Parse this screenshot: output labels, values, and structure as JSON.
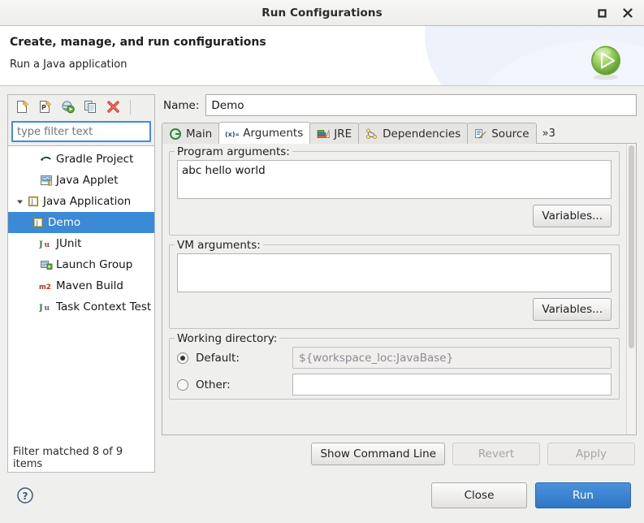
{
  "window": {
    "title": "Run Configurations",
    "buttons": [
      {
        "name": "maximize-button",
        "label": "maximize-icon"
      },
      {
        "name": "close-button",
        "label": "close-icon"
      }
    ]
  },
  "header": {
    "title": "Create, manage, and run configurations",
    "subtitle": "Run a Java application",
    "icon": "run-green-play-icon"
  },
  "left_panel": {
    "toolbar": [
      {
        "name": "new-configuration-button",
        "icon": "new-launch-config-icon",
        "tooltip": "New launch configuration"
      },
      {
        "name": "new-prototype-button",
        "icon": "new-prototype-icon",
        "tooltip": "New prototype"
      },
      {
        "name": "export-button",
        "icon": "export-icon",
        "tooltip": "Export"
      },
      {
        "name": "duplicate-button",
        "icon": "duplicate-icon",
        "tooltip": "Duplicate"
      },
      {
        "name": "delete-button",
        "icon": "delete-red-x-icon",
        "tooltip": "Delete"
      }
    ],
    "filter": {
      "value": "",
      "placeholder": "type filter text"
    },
    "tree": [
      {
        "label": "Gradle Project",
        "icon": "gradle-icon",
        "indent": 1,
        "twisty": "",
        "selected": false
      },
      {
        "label": "Java Applet",
        "icon": "java-applet-icon",
        "indent": 1,
        "twisty": "",
        "selected": false
      },
      {
        "label": "Java Application",
        "icon": "java-application-icon",
        "indent": 0,
        "twisty": "expanded",
        "selected": false
      },
      {
        "label": "Demo",
        "icon": "java-application-icon",
        "indent": 2,
        "twisty": "",
        "selected": true
      },
      {
        "label": "JUnit",
        "icon": "junit-icon",
        "indent": 1,
        "twisty": "",
        "selected": false
      },
      {
        "label": "Launch Group",
        "icon": "launch-group-icon",
        "indent": 1,
        "twisty": "",
        "selected": false
      },
      {
        "label": "Maven Build",
        "icon": "maven-icon",
        "indent": 1,
        "twisty": "",
        "selected": false
      },
      {
        "label": "Task Context Test",
        "icon": "task-context-test-icon",
        "indent": 1,
        "twisty": "",
        "selected": false
      }
    ],
    "status": "Filter matched 8 of 9 items"
  },
  "config": {
    "name_label": "Name:",
    "name_value": "Demo",
    "tabs": [
      {
        "label": "Main",
        "icon": "main-green-circle-icon",
        "active": false
      },
      {
        "label": "Arguments",
        "icon": "arguments-xeq-icon",
        "active": true
      },
      {
        "label": "JRE",
        "icon": "jre-books-icon",
        "active": false
      },
      {
        "label": "Dependencies",
        "icon": "dependencies-icon",
        "active": false
      },
      {
        "label": "Source",
        "icon": "source-icon",
        "active": false
      },
      {
        "label": "»3",
        "icon": "overflow-chevron-icon",
        "active": false
      }
    ],
    "program_arguments": {
      "legend": "Program arguments:",
      "value": "abc hello world",
      "variables_button": "Variables..."
    },
    "vm_arguments": {
      "legend": "VM arguments:",
      "value": "",
      "variables_button": "Variables..."
    },
    "working_directory": {
      "legend": "Working directory:",
      "default_label": "Default:",
      "default_value": "${workspace_loc:JavaBase}",
      "default_selected": true,
      "other_label": "Other:",
      "other_value": "",
      "other_selected": false
    },
    "actions": {
      "show_command_line": "Show Command Line",
      "revert": "Revert",
      "apply": "Apply"
    }
  },
  "footer": {
    "help_icon": "help-question-icon",
    "close": "Close",
    "run": "Run"
  },
  "colors": {
    "selection_blue": "#3b8ad8",
    "primary_button": "#3a84d2",
    "run_icon_green": "#7cc04a",
    "dialog_bg": "#efefee"
  }
}
